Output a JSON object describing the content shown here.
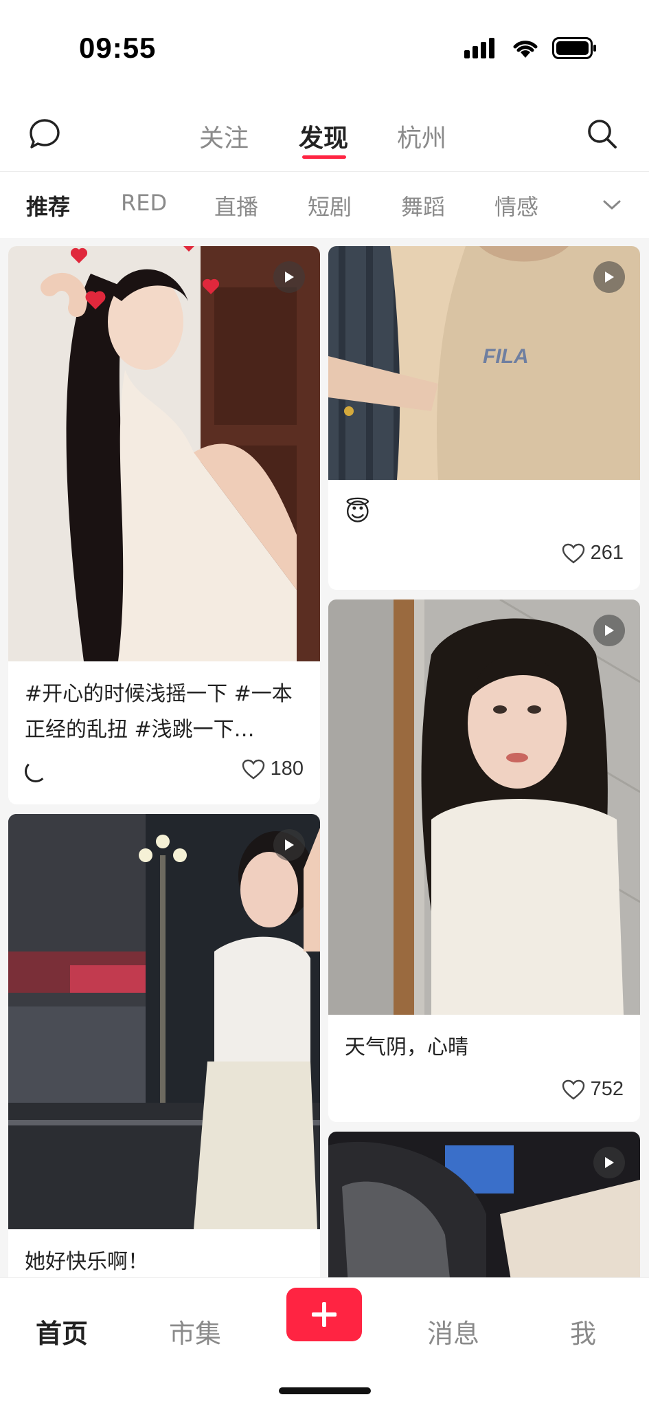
{
  "status": {
    "time": "09:55"
  },
  "top_nav": {
    "tabs": [
      {
        "label": "关注"
      },
      {
        "label": "发现"
      },
      {
        "label": "杭州"
      }
    ],
    "active_tab": "发现",
    "accent_color": "#ff2442"
  },
  "categories": {
    "items": [
      "推荐",
      "RED",
      "直播",
      "短剧",
      "舞蹈",
      "情感"
    ],
    "active": "推荐"
  },
  "feed": {
    "left": [
      {
        "title": "#开心的时候浅摇一下 #一本正经的乱扭 #浅跳一下…",
        "likes": "180",
        "video": true
      },
      {
        "title": "她好快乐啊！",
        "video": true
      }
    ],
    "right": [
      {
        "title": "😇",
        "likes": "261",
        "video": true
      },
      {
        "title": "天气阴，心晴",
        "likes": "752",
        "video": true
      },
      {
        "video": true
      }
    ]
  },
  "tab_bar": {
    "items": [
      {
        "label": "首页"
      },
      {
        "label": "市集"
      },
      {
        "label": "消息"
      },
      {
        "label": "我"
      }
    ],
    "active": "首页",
    "post_icon": "plus-icon"
  }
}
